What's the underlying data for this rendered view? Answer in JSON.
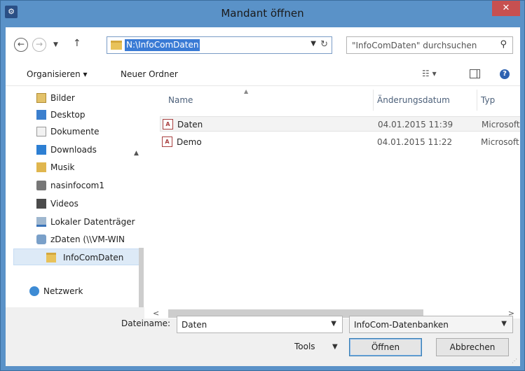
{
  "window": {
    "title": "Mandant öffnen",
    "close_glyph": "✕"
  },
  "address": {
    "path": "N:\\InfoComDaten",
    "search_placeholder": "\"InfoComDaten\" durchsuchen"
  },
  "toolbar": {
    "organize_label": "Organisieren ▾",
    "new_folder_label": "Neuer Ordner"
  },
  "nav_pane": {
    "items": [
      {
        "label": "Bilder",
        "icon": "pictures-icon"
      },
      {
        "label": "Desktop",
        "icon": "desktop-icon"
      },
      {
        "label": "Dokumente",
        "icon": "documents-icon"
      },
      {
        "label": "Downloads",
        "icon": "downloads-icon"
      },
      {
        "label": "Musik",
        "icon": "music-icon"
      },
      {
        "label": "nasinfocom1",
        "icon": "computer-icon"
      },
      {
        "label": "Videos",
        "icon": "videos-icon"
      },
      {
        "label": "Lokaler Datenträger",
        "icon": "drive-icon"
      },
      {
        "label": "zDaten (\\\\VM-WIN",
        "icon": "network-drive-icon"
      },
      {
        "label": "InfoComDaten",
        "icon": "folder-icon",
        "selected": true
      },
      {
        "label": "Netzwerk",
        "icon": "network-icon"
      }
    ]
  },
  "file_list": {
    "columns": {
      "name": "Name",
      "date": "Änderungsdatum",
      "type": "Typ"
    },
    "rows": [
      {
        "name": "Daten",
        "date": "04.01.2015 11:39",
        "type": "Microsoft"
      },
      {
        "name": "Demo",
        "date": "04.01.2015 11:22",
        "type": "Microsoft"
      }
    ]
  },
  "footer": {
    "filename_label": "Dateiname:",
    "filename_value": "Daten",
    "filetype_value": "InfoCom-Datenbanken",
    "tools_label": "Tools",
    "open_label": "Öffnen",
    "cancel_label": "Abbrechen"
  },
  "colors": {
    "titlebar": "#5a92c8",
    "close": "#c75050",
    "selection": "#ddeaf7",
    "address_highlight": "#3a7bd5"
  }
}
